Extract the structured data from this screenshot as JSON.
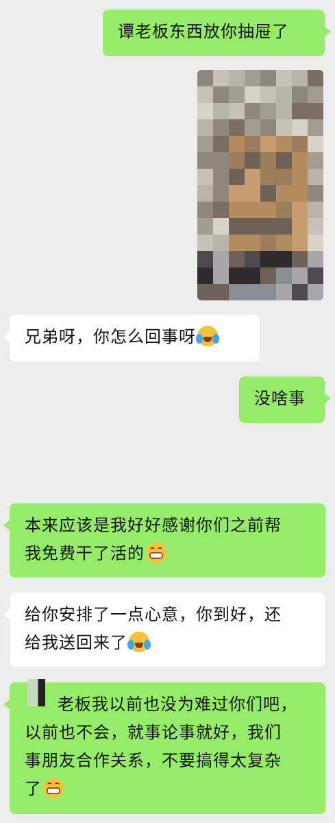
{
  "messages": [
    {
      "side": "right",
      "text": "谭老板东西放你抽屉了"
    },
    {
      "side": "right",
      "type": "image",
      "image_name": "pixelated-photo"
    },
    {
      "side": "left",
      "text": "兄弟呀，你怎么回事呀",
      "emoji": "crying-laughing-emoji"
    },
    {
      "side": "right",
      "text": "没啥事"
    },
    {
      "side": "left",
      "lines": [
        "本来应该是我好好感谢你们之前帮",
        "我免费干了活的"
      ],
      "emoji": "grin-emoji"
    },
    {
      "side": "left",
      "lines": [
        "给你安排了一点心意，你到好，还",
        "给我送回来了"
      ],
      "emoji": "crying-laughing-emoji"
    },
    {
      "side": "left",
      "lines": [
        "老板我以前也没为难过你们吧，",
        "以前也不会，就事论事就好，我们",
        "事朋友合作关系，不要搞得太复杂",
        "了"
      ],
      "emoji": "grin-emoji"
    }
  ],
  "colors": {
    "background": "#ededed",
    "sent_bubble": "#95ec69",
    "received_bubble": "#ffffff"
  }
}
